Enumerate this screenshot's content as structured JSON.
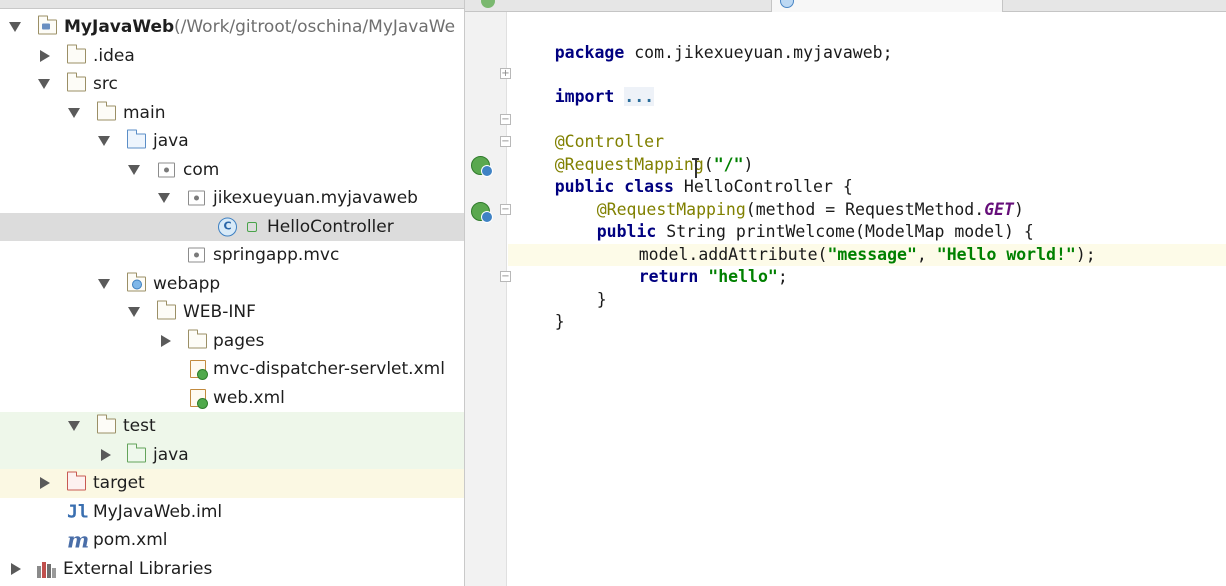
{
  "project_tree": {
    "items": [
      {
        "name": "root",
        "label": "MyJavaWeb",
        "path": "(/Work/gitroot/oschina/MyJavaWe"
      },
      {
        "name": "idea",
        "label": ".idea"
      },
      {
        "name": "src",
        "label": "src"
      },
      {
        "name": "main",
        "label": "main"
      },
      {
        "name": "java",
        "label": "java"
      },
      {
        "name": "com",
        "label": "com"
      },
      {
        "name": "package",
        "label": "jikexueyuan.myjavaweb"
      },
      {
        "name": "hello-controller",
        "label": "HelloController",
        "class_badge": "C"
      },
      {
        "name": "springapp",
        "label": "springapp.mvc"
      },
      {
        "name": "webapp",
        "label": "webapp"
      },
      {
        "name": "web-inf",
        "label": "WEB-INF"
      },
      {
        "name": "pages",
        "label": "pages"
      },
      {
        "name": "dispatcher-xml",
        "label": "mvc-dispatcher-servlet.xml"
      },
      {
        "name": "web-xml",
        "label": "web.xml"
      },
      {
        "name": "test",
        "label": "test"
      },
      {
        "name": "test-java",
        "label": "java"
      },
      {
        "name": "target",
        "label": "target"
      },
      {
        "name": "iml",
        "label": "MyJavaWeb.iml",
        "icon_glyph": "Jl"
      },
      {
        "name": "pom",
        "label": "pom.xml",
        "icon_glyph": "m"
      },
      {
        "name": "external-libraries",
        "label": "External Libraries"
      }
    ]
  },
  "editor": {
    "tabs": [
      {
        "name": "dispatcher-tab",
        "icon": "xml-file-icon"
      },
      {
        "name": "hello-controller-tab",
        "icon": "java-class-icon",
        "active": true
      }
    ],
    "fold_collapsed": "+",
    "fold_expanded": "−",
    "code": {
      "line1": {
        "kw": "package",
        "rest": " com.jikexueyuan.myjavaweb;"
      },
      "line3": {
        "kw": "import",
        "sp": " ",
        "fold": "..."
      },
      "line5": {
        "ann": "@Controller"
      },
      "line6": {
        "ann": "@RequestMapping",
        "open": "(",
        "str": "\"/\"",
        "close": ")"
      },
      "line7": {
        "kw": "public class",
        "rest": " HelloController {"
      },
      "line8": {
        "ann": "@RequestMapping",
        "rest": "(method = RequestMethod.",
        "const": "GET",
        "close": ")"
      },
      "line9": {
        "kw": "public",
        "rest": " String printWelcome(ModelMap model) {"
      },
      "line10": {
        "pre": "model.addAttribute(",
        "str1": "\"message\"",
        "sep": ", ",
        "str2": "\"Hello world!\"",
        "post": ");"
      },
      "line11": {
        "kw": "return",
        "sp": " ",
        "str": "\"hello\"",
        "post": ";"
      },
      "line12": {
        "text": "}"
      },
      "line13": {
        "text": "}"
      }
    }
  },
  "colors": {
    "keyword": "#000080",
    "annotation": "#808000",
    "string": "#008000",
    "constant": "#660e7a",
    "selection": "#dcdcdc",
    "current_line": "#fdfbe8"
  }
}
